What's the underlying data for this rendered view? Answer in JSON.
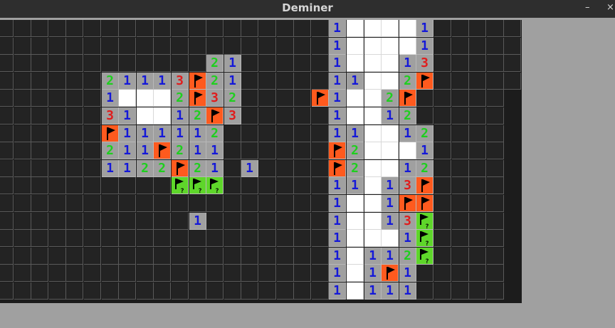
{
  "window": {
    "title": "Deminer",
    "minimize_label": "–",
    "close_label": "×"
  },
  "colors": {
    "1": "#1418d8",
    "2": "#1ecf1e",
    "3": "#e01c1c",
    "hidden": "#232323",
    "open": "#a0a0a0",
    "empty": "#ffffff",
    "flag_bg": "#ff5a1e",
    "question_bg": "#5ed62a"
  },
  "icons": {
    "flag": "flag-icon",
    "question": "question-flag-icon"
  },
  "legend": "#=hidden .=open-no-number W=empty-white 1-3=number F=flag Q=question-flag",
  "board": {
    "cols": 30,
    "rows": 16,
    "grid": [
      "###################1WWWW1#####",
      "###################1WWWW1#####",
      "############21#####1WWW13#####",
      "######21113F21#####11WW2F#####",
      "######1WWW2F32####F1WW2F#####",
      "######31WW12F3#####1WW12#####",
      "######F111112######11WW12####",
      "######211F211######F2WWW1####",
      "######1122F21#1####F2WW12####",
      "##########QQQ######11W13F####",
      "###################1WW1FF####",
      "###########1#######1WW13Q####",
      "###################1WWW1Q####",
      "###################1W112Q####",
      "###################1W1F1#####",
      "###################1W111#####"
    ]
  }
}
